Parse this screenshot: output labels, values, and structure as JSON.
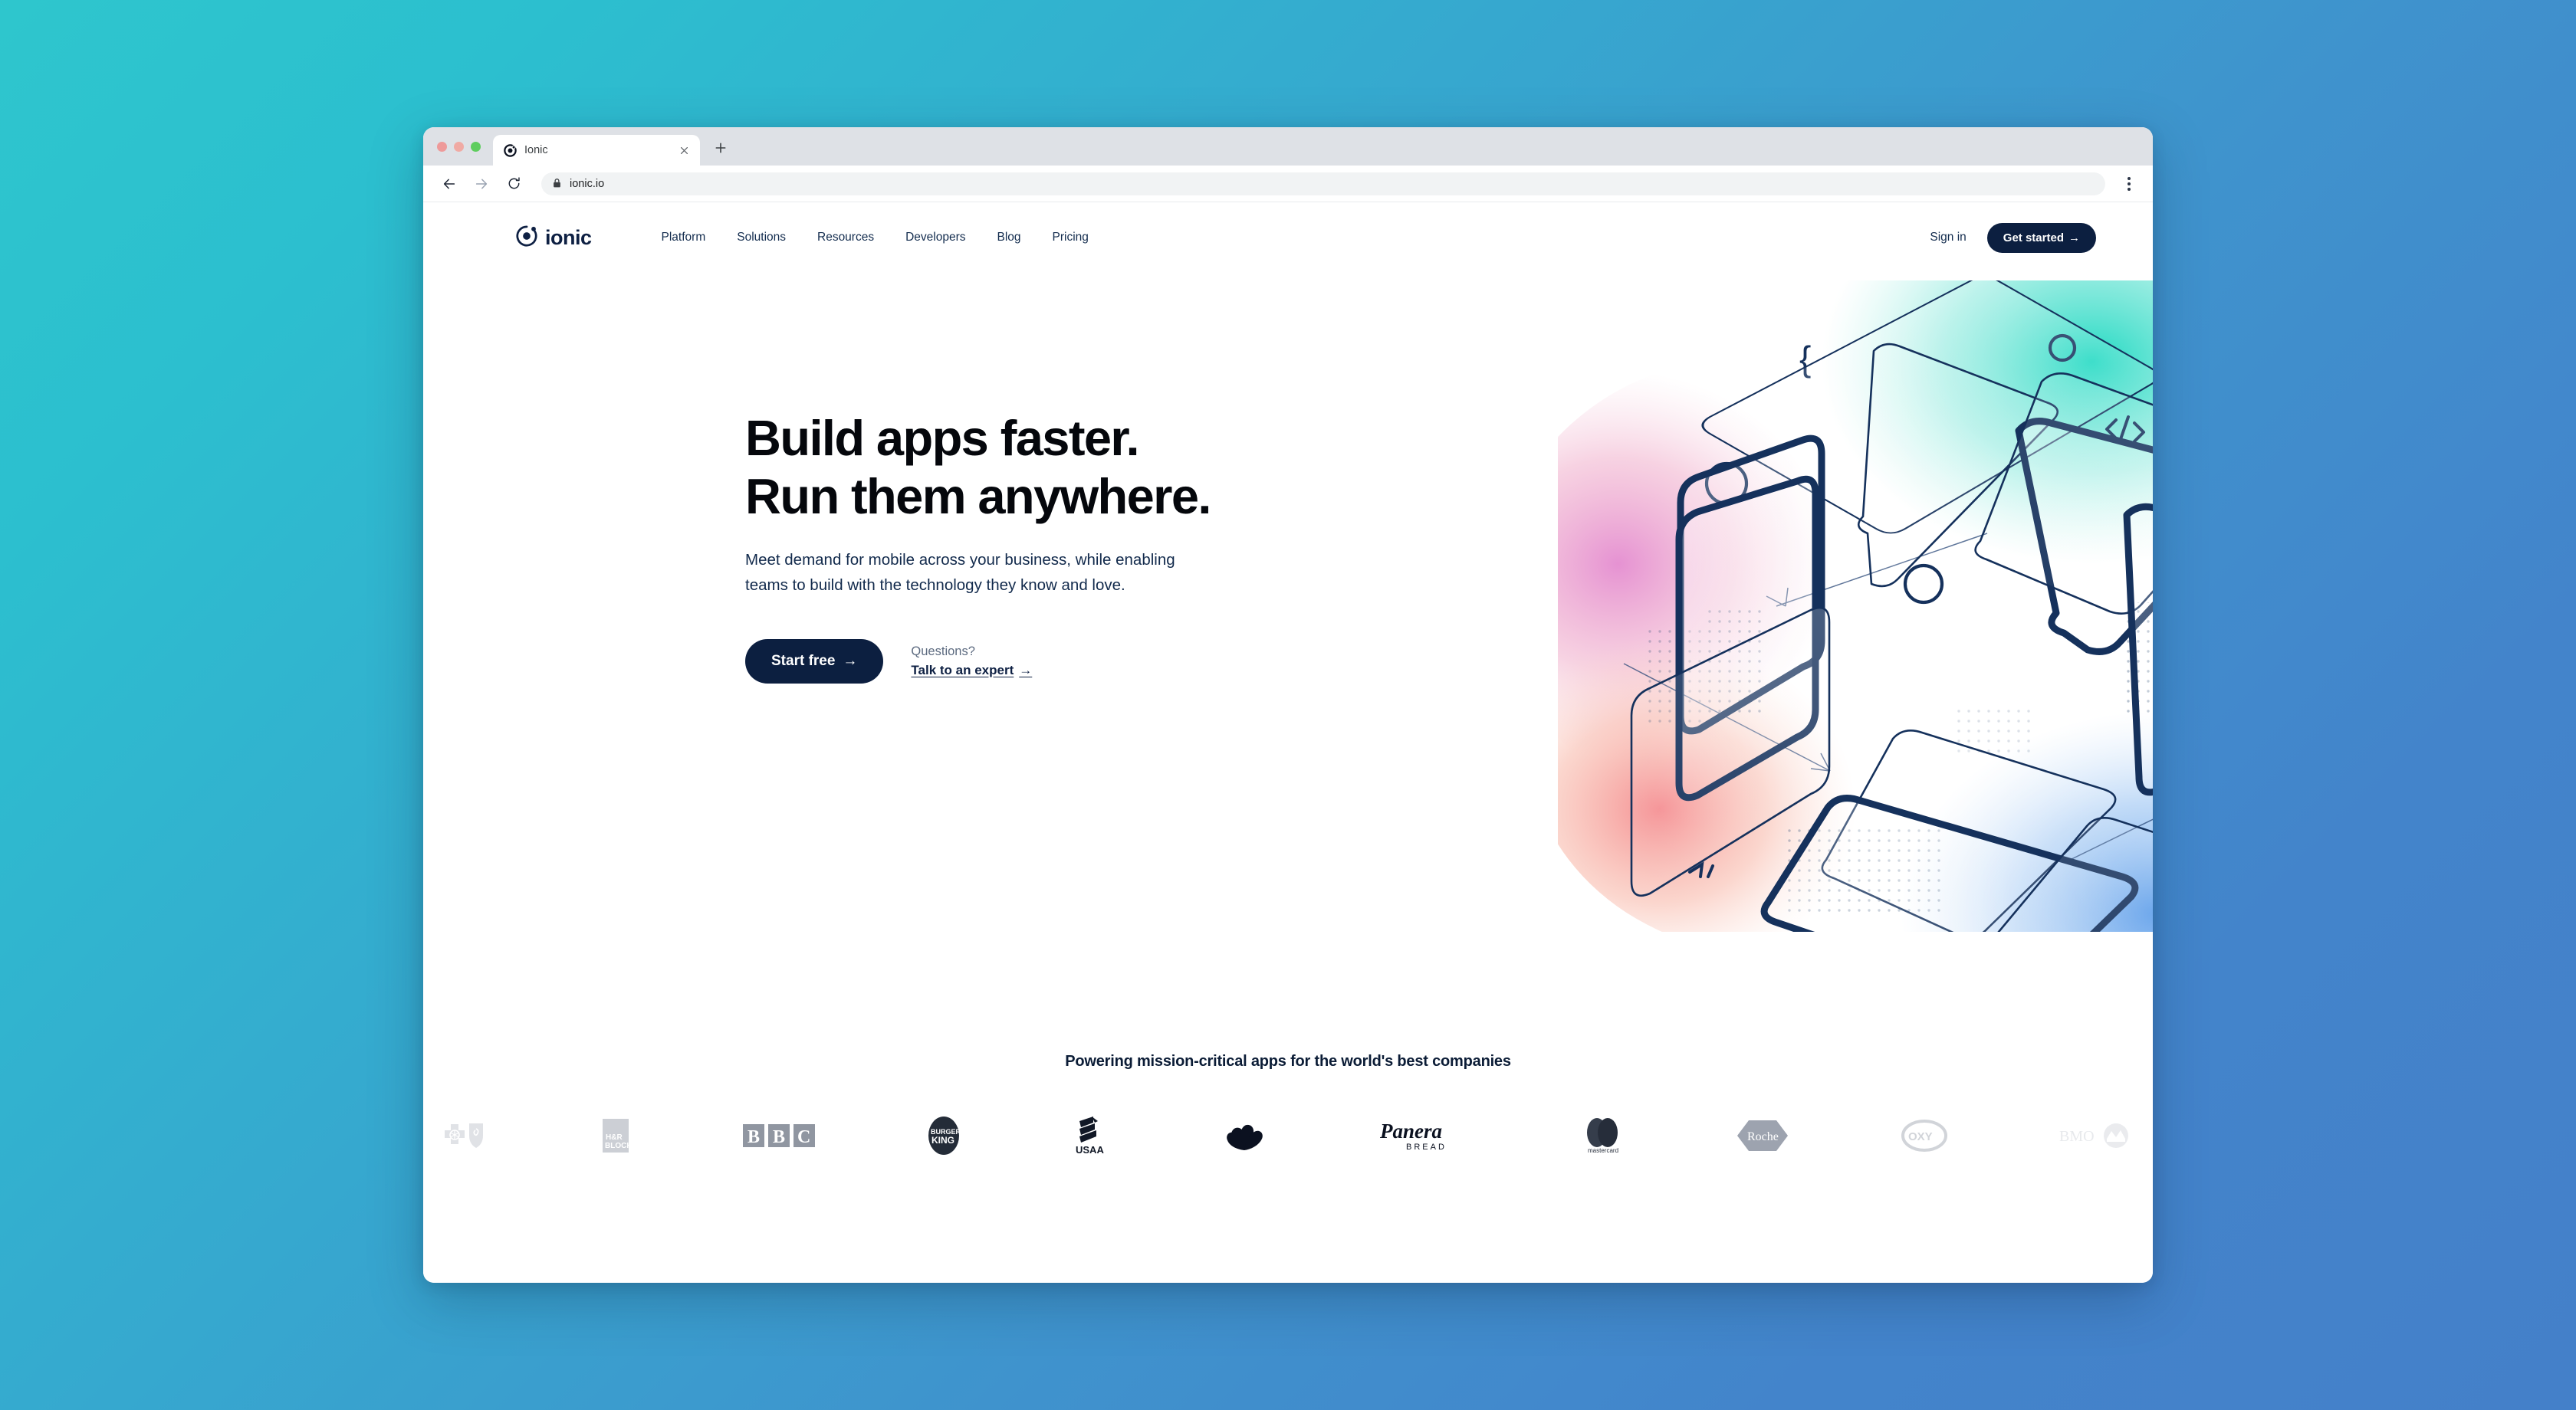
{
  "desktop": {
    "gradient_start": "#2ec6cd",
    "gradient_end": "#4480c9"
  },
  "browser": {
    "tab": {
      "title": "Ionic",
      "favicon_icon": "ionic-favicon-icon",
      "close_icon": "close-icon"
    },
    "new_tab_icon": "plus-icon",
    "back_icon": "back-arrow-icon",
    "forward_icon": "forward-arrow-icon",
    "reload_icon": "reload-icon",
    "lock_icon": "lock-icon",
    "url": "ionic.io",
    "menu_icon": "kebab-menu-icon",
    "traffic_lights": [
      "close-window-dot",
      "minimize-window-dot",
      "maximize-window-dot"
    ]
  },
  "site": {
    "brand": {
      "logo_icon": "ionic-logo-icon",
      "wordmark": "ionic"
    },
    "nav": [
      {
        "label": "Platform"
      },
      {
        "label": "Solutions"
      },
      {
        "label": "Resources"
      },
      {
        "label": "Developers"
      },
      {
        "label": "Blog"
      },
      {
        "label": "Pricing"
      }
    ],
    "signin_label": "Sign in",
    "get_started_label": "Get started",
    "get_started_arrow": "→"
  },
  "hero": {
    "title": "Build apps faster.\nRun them anywhere.",
    "subtitle": "Meet demand for mobile across your business, while enabling\nteams to build with the technology they know and love.",
    "primary_cta": {
      "label": "Start free",
      "arrow": "→"
    },
    "questions_label": "Questions?",
    "expert_link": "Talk to an expert",
    "expert_arrow": "→",
    "illustration": {
      "name": "isometric-cube-gradient-illustration",
      "accents": [
        "curly-brace-glyph",
        "code-tag-glyph",
        "circle-outline",
        "arrow-glyph",
        "dot-grid-pattern"
      ],
      "gradient_colors": [
        "#7fe3d6",
        "#2fd3c0",
        "#d89bd2",
        "#f0909a",
        "#f3a68f",
        "#6aa6e8",
        "#a8c9f2"
      ],
      "stroke_color": "#15315c"
    }
  },
  "logos": {
    "heading": "Powering mission-critical apps for the world's best companies",
    "items": [
      {
        "name": "blue-cross-blue-shield",
        "label": "Blue Cross Blue Shield",
        "opacity": 0.18
      },
      {
        "name": "hr-block",
        "label": "H&R BLOCK",
        "opacity": 0.34
      },
      {
        "name": "bbc",
        "label": "BBC",
        "opacity": 0.68
      },
      {
        "name": "burger-king",
        "label": "BURGER KING",
        "opacity": 0.95
      },
      {
        "name": "usaa",
        "label": "USAA",
        "opacity": 1
      },
      {
        "name": "nbc",
        "label": "NBC",
        "opacity": 1
      },
      {
        "name": "panera-bread",
        "label": "Panera BREAD",
        "opacity": 1
      },
      {
        "name": "mastercard",
        "label": "mastercard",
        "opacity": 0.95
      },
      {
        "name": "roche",
        "label": "Roche",
        "opacity": 0.66
      },
      {
        "name": "oxy",
        "label": "OXY",
        "opacity": 0.34
      },
      {
        "name": "bmo",
        "label": "BMO",
        "opacity": 0.16
      }
    ]
  }
}
